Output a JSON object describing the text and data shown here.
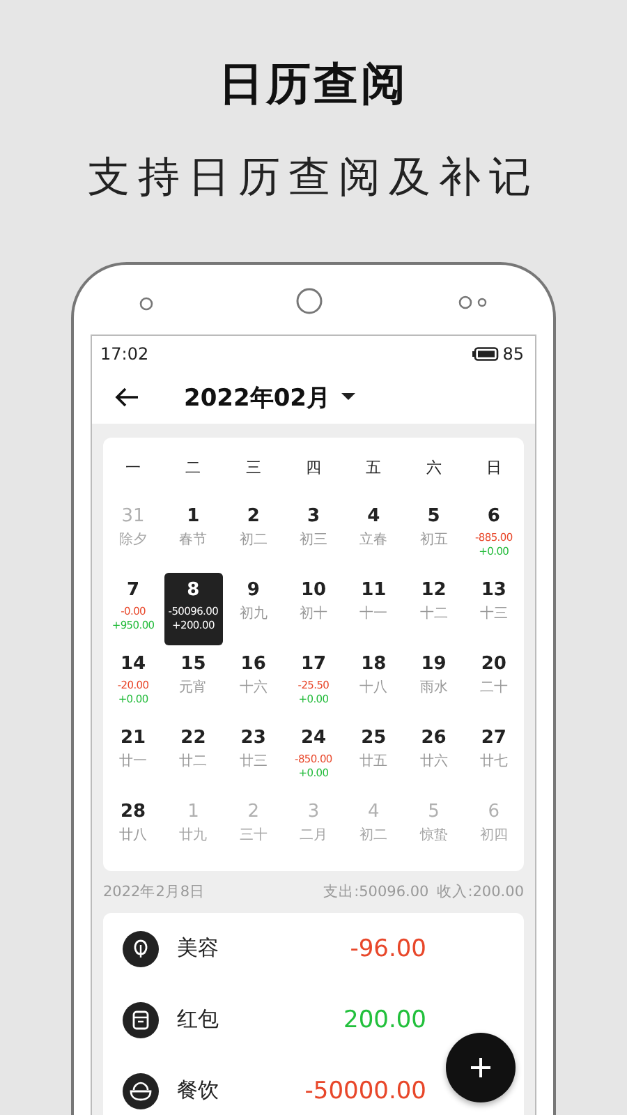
{
  "heading": "日历查阅",
  "subheading": "支持日历查阅及补记",
  "status_bar": {
    "time": "17:02",
    "battery": "85"
  },
  "header": {
    "title": "2022年02月"
  },
  "calendar": {
    "weekdays": [
      "一",
      "二",
      "三",
      "四",
      "五",
      "六",
      "日"
    ],
    "days": [
      {
        "date": "31",
        "lunar": "除夕",
        "in_month": false,
        "selected": false
      },
      {
        "date": "1",
        "lunar": "春节",
        "in_month": true,
        "selected": false
      },
      {
        "date": "2",
        "lunar": "初二",
        "in_month": true,
        "selected": false
      },
      {
        "date": "3",
        "lunar": "初三",
        "in_month": true,
        "selected": false
      },
      {
        "date": "4",
        "lunar": "立春",
        "in_month": true,
        "selected": false
      },
      {
        "date": "5",
        "lunar": "初五",
        "in_month": true,
        "selected": false
      },
      {
        "date": "6",
        "expense": "-885.00",
        "income": "+0.00",
        "in_month": true,
        "selected": false
      },
      {
        "date": "7",
        "expense": "-0.00",
        "income": "+950.00",
        "in_month": true,
        "selected": false
      },
      {
        "date": "8",
        "expense": "-50096.00",
        "income": "+200.00",
        "in_month": true,
        "selected": true
      },
      {
        "date": "9",
        "lunar": "初九",
        "in_month": true,
        "selected": false
      },
      {
        "date": "10",
        "lunar": "初十",
        "in_month": true,
        "selected": false
      },
      {
        "date": "11",
        "lunar": "十一",
        "in_month": true,
        "selected": false
      },
      {
        "date": "12",
        "lunar": "十二",
        "in_month": true,
        "selected": false
      },
      {
        "date": "13",
        "lunar": "十三",
        "in_month": true,
        "selected": false
      },
      {
        "date": "14",
        "expense": "-20.00",
        "income": "+0.00",
        "in_month": true,
        "selected": false
      },
      {
        "date": "15",
        "lunar": "元宵",
        "in_month": true,
        "selected": false
      },
      {
        "date": "16",
        "lunar": "十六",
        "in_month": true,
        "selected": false
      },
      {
        "date": "17",
        "expense": "-25.50",
        "income": "+0.00",
        "in_month": true,
        "selected": false
      },
      {
        "date": "18",
        "lunar": "十八",
        "in_month": true,
        "selected": false
      },
      {
        "date": "19",
        "lunar": "雨水",
        "in_month": true,
        "selected": false
      },
      {
        "date": "20",
        "lunar": "二十",
        "in_month": true,
        "selected": false
      },
      {
        "date": "21",
        "lunar": "廿一",
        "in_month": true,
        "selected": false
      },
      {
        "date": "22",
        "lunar": "廿二",
        "in_month": true,
        "selected": false
      },
      {
        "date": "23",
        "lunar": "廿三",
        "in_month": true,
        "selected": false
      },
      {
        "date": "24",
        "expense": "-850.00",
        "income": "+0.00",
        "in_month": true,
        "selected": false
      },
      {
        "date": "25",
        "lunar": "廿五",
        "in_month": true,
        "selected": false
      },
      {
        "date": "26",
        "lunar": "廿六",
        "in_month": true,
        "selected": false
      },
      {
        "date": "27",
        "lunar": "廿七",
        "in_month": true,
        "selected": false
      },
      {
        "date": "28",
        "lunar": "廿八",
        "in_month": true,
        "selected": false
      },
      {
        "date": "1",
        "lunar": "廿九",
        "in_month": false,
        "selected": false
      },
      {
        "date": "2",
        "lunar": "三十",
        "in_month": false,
        "selected": false
      },
      {
        "date": "3",
        "lunar": "二月",
        "in_month": false,
        "selected": false
      },
      {
        "date": "4",
        "lunar": "初二",
        "in_month": false,
        "selected": false
      },
      {
        "date": "5",
        "lunar": "惊蛰",
        "in_month": false,
        "selected": false
      },
      {
        "date": "6",
        "lunar": "初四",
        "in_month": false,
        "selected": false
      }
    ]
  },
  "day_summary": {
    "date": "2022年2月8日",
    "expense": "支出:50096.00",
    "income": "收入:200.00"
  },
  "records": [
    {
      "category": "美容",
      "amount": "-96.00",
      "kind": "expense"
    },
    {
      "category": "红包",
      "amount": "200.00",
      "kind": "income"
    },
    {
      "category": "餐饮",
      "amount": "-50000.00",
      "kind": "expense"
    }
  ]
}
